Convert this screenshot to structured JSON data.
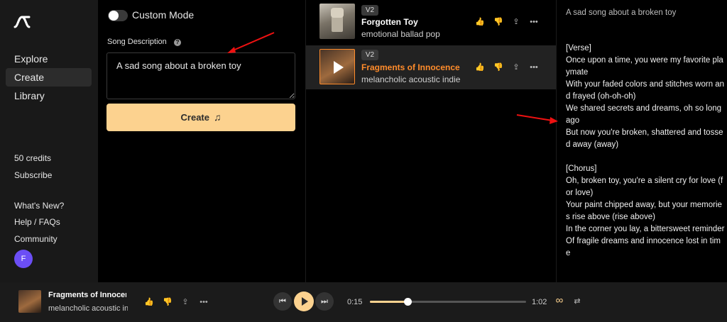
{
  "sidebar": {
    "logo_icon": "waveform-logo-icon",
    "nav": [
      {
        "label": "Explore"
      },
      {
        "label": "Create"
      },
      {
        "label": "Library"
      }
    ],
    "credits": "50 credits",
    "subscribe": "Subscribe",
    "links": [
      {
        "label": "What's New?"
      },
      {
        "label": "Help / FAQs"
      },
      {
        "label": "Community"
      }
    ],
    "avatar_initial": "F"
  },
  "create": {
    "custom_mode_label": "Custom Mode",
    "description_label": "Song Description",
    "description_value": "A sad song about a broken toy",
    "create_label": "Create",
    "accent_color": "#fcd28f"
  },
  "songs": [
    {
      "version": "V2",
      "title": "Forgotten Toy",
      "genre": "emotional ballad pop",
      "selected": false
    },
    {
      "version": "V2",
      "title": "Fragments of Innocence",
      "genre": "melancholic acoustic indie",
      "selected": true
    }
  ],
  "lyrics": {
    "title": "A sad song about a broken toy",
    "lines": [
      "[Verse]",
      "Once upon a time, you were my favorite playmate",
      "With your faded colors and stitches worn and frayed (oh-oh-oh)",
      "We shared secrets and dreams, oh so long ago",
      "But now you're broken, shattered and tossed away (away)",
      "",
      "[Chorus]",
      "Oh, broken toy, you're a silent cry for love (for love)",
      "Your paint chipped away, but your memories rise above (rise above)",
      "In the corner you lay, a bittersweet reminder",
      "Of fragile dreams and innocence lost in time"
    ]
  },
  "player": {
    "title": "Fragments of Innocen",
    "genre": "melancholic acoustic indi",
    "current_time": "0:15",
    "total_time": "1:02",
    "progress": 0.24
  }
}
